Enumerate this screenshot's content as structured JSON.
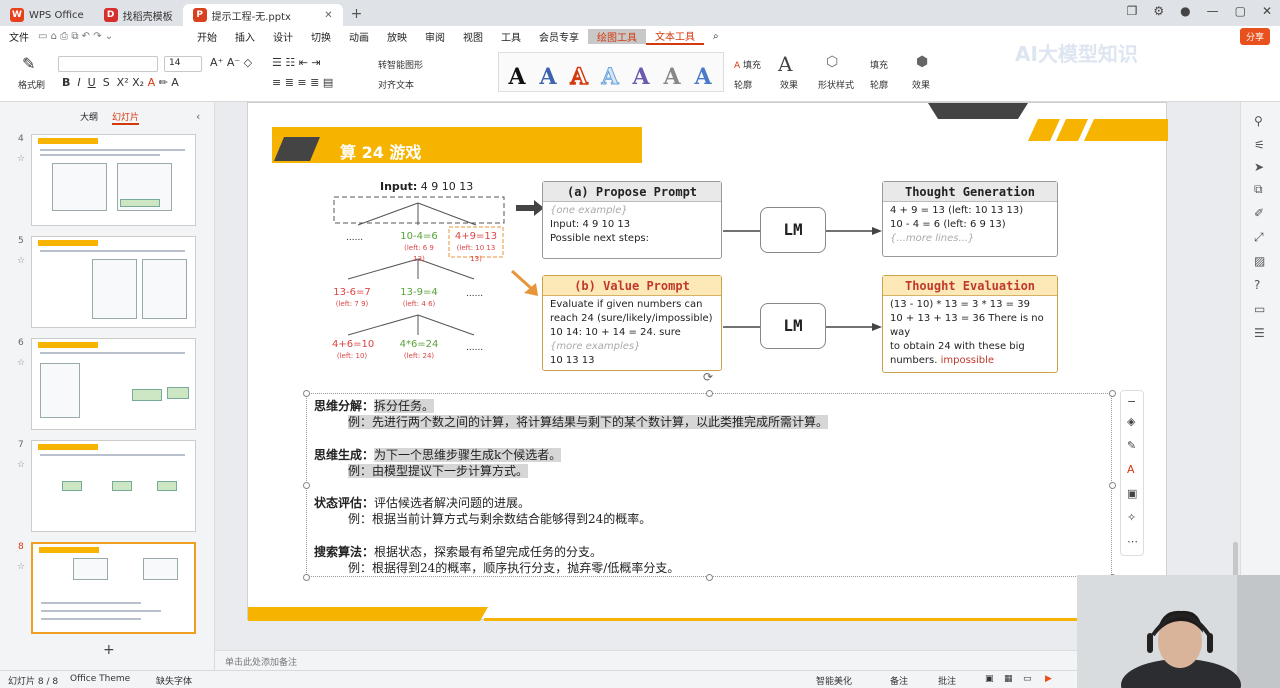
{
  "tabs": [
    {
      "label": "WPS Office",
      "active": false
    },
    {
      "label": "找稻壳模板",
      "active": false
    },
    {
      "label": "提示工程-无.pptx",
      "active": true
    }
  ],
  "menu": {
    "file": "文件",
    "items": [
      "开始",
      "插入",
      "设计",
      "切换",
      "动画",
      "放映",
      "审阅",
      "视图",
      "工具",
      "会员专享"
    ],
    "drawing_tools": "绘图工具",
    "text_tools": "文本工具",
    "share": "分享"
  },
  "ribbon": {
    "format_painter": "格式刷",
    "font_size": "14",
    "smart_shape": "转智能图形",
    "align_text": "对齐文本",
    "fill": "填充",
    "outline": "轮廓",
    "effect": "效果",
    "shape_style": "形状样式",
    "fill2": "填充",
    "outline2": "轮廓",
    "effect2": "效果",
    "watermark": "AI大模型知识"
  },
  "left_panel": {
    "tab_outline": "大纲",
    "tab_slides": "幻灯片",
    "slide_numbers": [
      "4",
      "5",
      "6",
      "7",
      "8"
    ],
    "add": "+"
  },
  "slide": {
    "title": "算 24 游戏",
    "tree": {
      "input_label": "Input:",
      "input_value": "4 9 10 13",
      "dots1": "......",
      "n1": "10-4=6",
      "n1_left": "(left: 6 9 13)",
      "n2": "4+9=13",
      "n2_left": "(left: 10 13 13)",
      "n3": "13-6=7",
      "n3_left": "(left: 7 9)",
      "n4": "13-9=4",
      "n4_left": "(left: 4 6)",
      "dots2": "......",
      "n5": "4+6=10",
      "n5_left": "(left: 10)",
      "n6": "4*6=24",
      "n6_left": "(left: 24)",
      "dots3": "......"
    },
    "propose": {
      "title": "(a) Propose Prompt",
      "l1": "{one example}",
      "l2": "Input: 4 9 10 13",
      "l3": "Possible next steps:"
    },
    "value": {
      "title": "(b) Value Prompt",
      "l1": "Evaluate if given numbers can",
      "l2": "reach 24 (sure/likely/impossible)",
      "l3": "10 14: 10 + 14 = 24. sure",
      "l4": "{more examples}",
      "l5": "10 13 13"
    },
    "lm": "LM",
    "generation": {
      "title": "Thought Generation",
      "l1": "4 + 9 = 13 (left: 10 13 13)",
      "l2": "10 - 4 = 6 (left: 6 9 13)",
      "l3": "{...more lines...}"
    },
    "evaluation": {
      "title": "Thought Evaluation",
      "l1": "(13 - 10) * 13 = 3 * 13 = 39",
      "l2": "10 + 13 + 13 = 36 There is no way",
      "l3": "to obtain 24 with these big",
      "l4": "numbers.",
      "l5": "impossible"
    },
    "text": {
      "h1": "思维分解：",
      "h1b": "拆分任务。",
      "e1": "例：先进行两个数之间的计算，将计算结果与剩下的某个数计算，以此类推完成所需计算。",
      "h2": "思维生成：",
      "h2b": "为下一个思维步骤生成k个候选者。",
      "e2": "例：由模型提议下一步计算方式。",
      "h3": "状态评估：",
      "h3b": "评估候选者解决问题的进展。",
      "e3": "例：根据当前计算方式与剩余数结合能够得到24的概率。",
      "h4": "搜索算法：",
      "h4b": "根据状态，探索最有希望完成任务的分支。",
      "e4": "例：根据得到24的概率，顺序执行分支，抛弃零/低概率分支。"
    }
  },
  "notes_placeholder": "单击此处添加备注",
  "status": {
    "slide": "幻灯片 8 / 8",
    "theme": "Office Theme",
    "font": "缺失字体",
    "beautify": "智能美化",
    "notes": "备注",
    "comment": "批注"
  },
  "colors": {
    "accent": "#f6b400",
    "wps_red": "#d4380d"
  }
}
